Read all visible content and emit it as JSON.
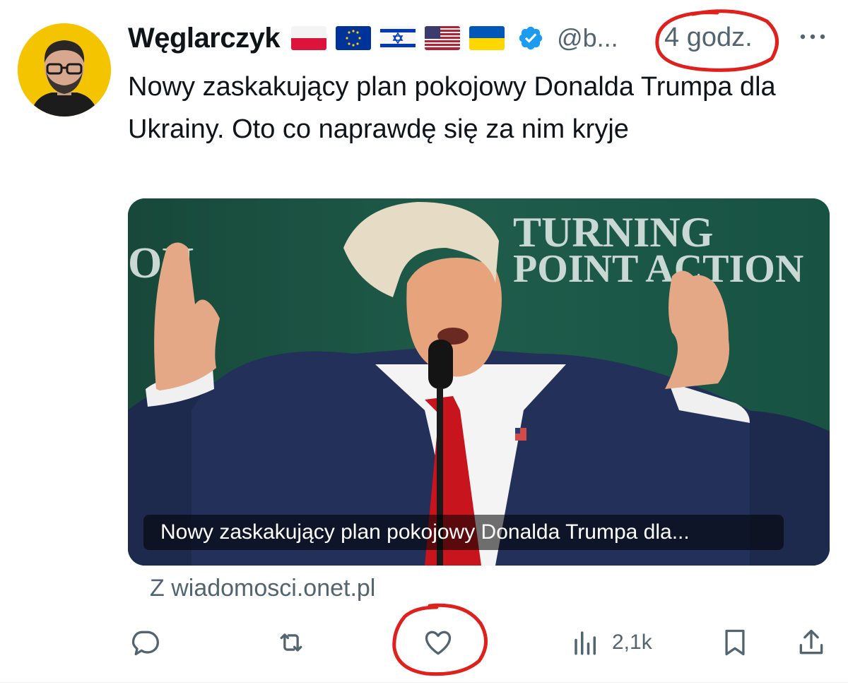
{
  "author": {
    "display_name": "Węglarczyk",
    "handle": "@b...",
    "flags": [
      "flag-poland-icon",
      "flag-eu-icon",
      "flag-israel-icon",
      "flag-usa-icon",
      "flag-ukraine-icon"
    ],
    "verified": true
  },
  "tweet": {
    "timestamp": "4 godz.",
    "text": "Nowy zaskakujący plan pokojowy Donalda Trumpa dla Ukrainy. Oto co naprawdę się za nim kryje"
  },
  "link_card": {
    "caption": "Nowy zaskakujący plan pokojowy Donalda Trumpa dla...",
    "backdrop_text_line1": "TURNING",
    "backdrop_text_line2": "POINT ACTION",
    "backdrop_text_left": "ON",
    "source": "Z wiadomosci.onet.pl"
  },
  "actions": {
    "reply_icon": "reply-icon",
    "retweet_icon": "retweet-icon",
    "like_icon": "heart-icon",
    "views_icon": "views-icon",
    "views_count": "2,1k",
    "bookmark_icon": "bookmark-icon",
    "share_icon": "share-icon"
  },
  "colors": {
    "text": "#0f1419",
    "secondary_text": "#536471",
    "verified": "#1d9bf0",
    "annotation": "#e0201c",
    "avatar_bg": "#f5c400",
    "media_bg": "#1e5a48"
  }
}
